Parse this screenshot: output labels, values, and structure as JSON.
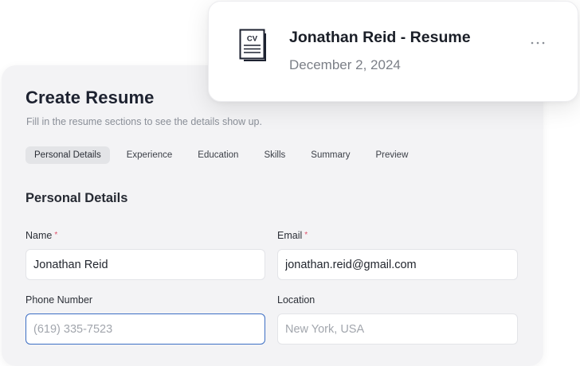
{
  "resume_card": {
    "title": "Jonathan Reid - Resume",
    "date": "December 2, 2024",
    "icon_text": "CV",
    "icon": "cv-document-icon",
    "more_icon": "more-horizontal-icon"
  },
  "form": {
    "title": "Create Resume",
    "subtitle": "Fill in the resume sections to see the details show up.",
    "tabs": [
      {
        "label": "Personal Details",
        "active": true
      },
      {
        "label": "Experience",
        "active": false
      },
      {
        "label": "Education",
        "active": false
      },
      {
        "label": "Skills",
        "active": false
      },
      {
        "label": "Summary",
        "active": false
      },
      {
        "label": "Preview",
        "active": false
      }
    ],
    "section_heading": "Personal Details",
    "fields": {
      "name": {
        "label": "Name",
        "required_mark": "*",
        "value": "Jonathan Reid",
        "placeholder": ""
      },
      "email": {
        "label": "Email",
        "required_mark": "*",
        "value": "jonathan.reid@gmail.com",
        "placeholder": ""
      },
      "phone": {
        "label": "Phone Number",
        "value": "",
        "placeholder": "(619) 335-7523"
      },
      "location": {
        "label": "Location",
        "value": "",
        "placeholder": "New York, USA"
      }
    }
  },
  "colors": {
    "accent_focus": "#3d6fc4",
    "required": "#e0516a",
    "card_bg": "#f3f3f5"
  }
}
